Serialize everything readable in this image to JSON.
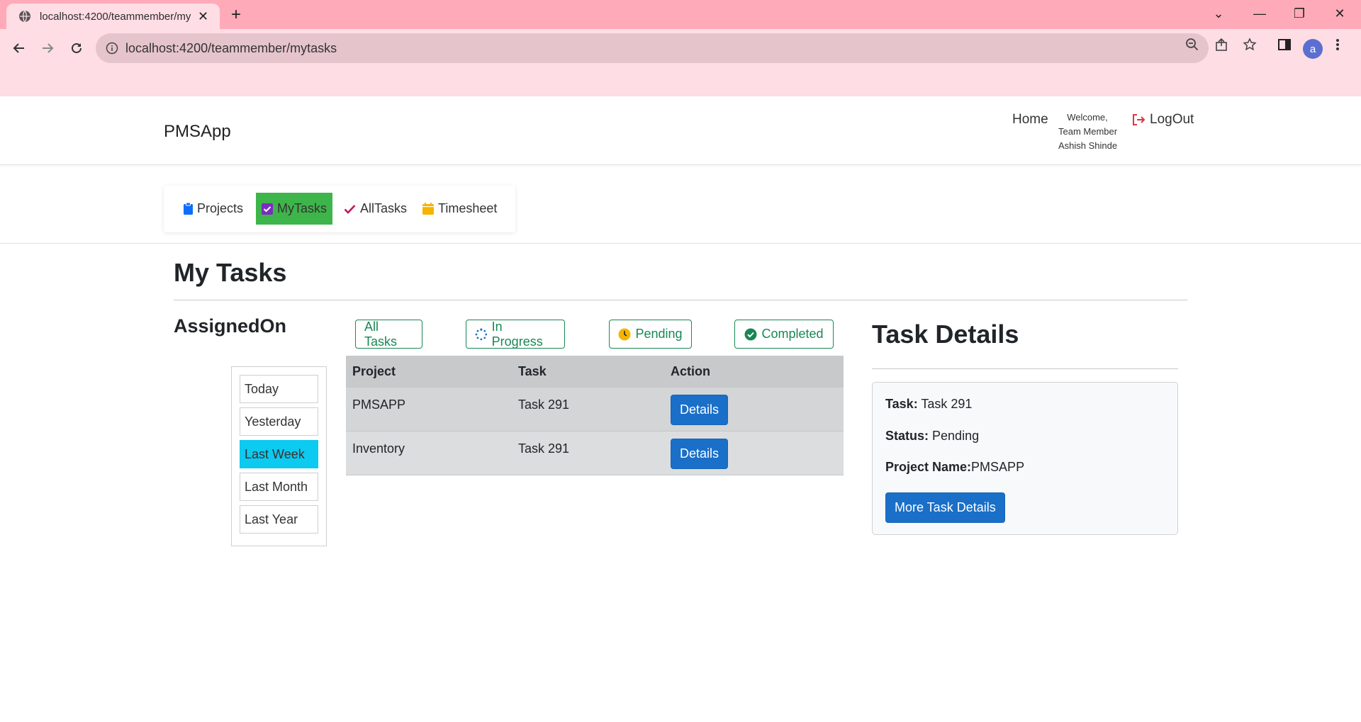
{
  "browser": {
    "tab_title": "localhost:4200/teammember/my",
    "url": "localhost:4200/teammember/mytasks",
    "profile_initial": "a"
  },
  "app": {
    "brand": "PMSApp",
    "nav_home": "Home",
    "welcome_line1": "Welcome,",
    "welcome_line2": "Team Member",
    "welcome_line3": "Ashish Shinde",
    "logout": "LogOut"
  },
  "menu": {
    "items": [
      {
        "label": "Projects",
        "icon": "clipboard-icon",
        "color": "#0d6efd"
      },
      {
        "label": "MyTasks",
        "icon": "checkbox-icon",
        "color": "#7b2cbf",
        "active": true
      },
      {
        "label": "AllTasks",
        "icon": "check-icon",
        "color": "#c2185b"
      },
      {
        "label": "Timesheet",
        "icon": "calendar-icon",
        "color": "#f5b400"
      }
    ]
  },
  "main": {
    "title": "My Tasks",
    "assigned_title": "AssignedOn",
    "ranges": [
      "Today",
      "Yesterday",
      "Last Week",
      "Last Month",
      "Last Year"
    ],
    "active_range": "Last Week",
    "filters": [
      {
        "label": "All Tasks",
        "icon": ""
      },
      {
        "label": "In Progress",
        "icon": "spinner-icon"
      },
      {
        "label": "Pending",
        "icon": "clock-icon"
      },
      {
        "label": "Completed",
        "icon": "check-circle-icon"
      }
    ],
    "table": {
      "headers": [
        "Project",
        "Task",
        "Action"
      ],
      "rows": [
        {
          "project": "PMSAPP",
          "task": "Task 291",
          "action": "Details"
        },
        {
          "project": "Inventory",
          "task": "Task 291",
          "action": "Details"
        }
      ]
    }
  },
  "details": {
    "title": "Task Details",
    "task_label": "Task:",
    "task_value": "Task 291",
    "status_label": "Status:",
    "status_value": "Pending",
    "project_label": "Project Name:",
    "project_value": "PMSAPP",
    "more_button": "More Task Details"
  },
  "colors": {
    "active_menu": "#3eb54a",
    "active_range": "#0dcaf0",
    "primary": "#1a6fc8",
    "success": "#198754",
    "logout_icon": "#dc3545"
  }
}
